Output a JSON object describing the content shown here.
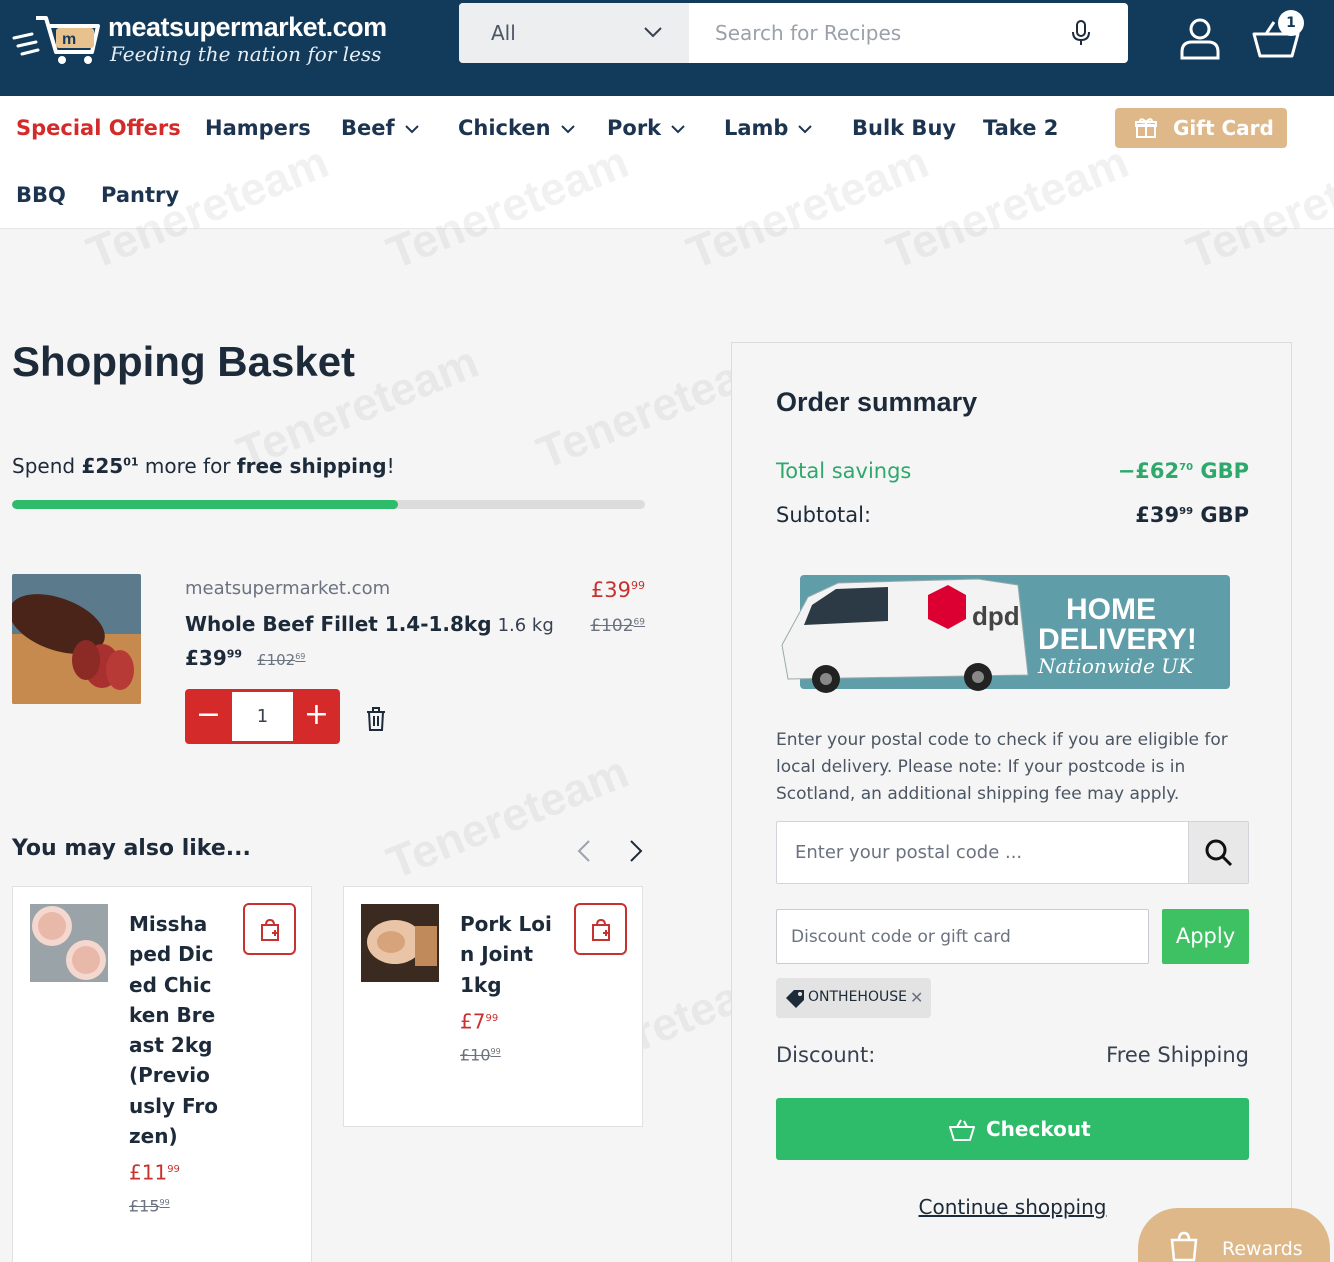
{
  "header": {
    "logo_name": "meatsupermarket.com",
    "logo_tagline": "Feeding the nation for less",
    "search_category": "All",
    "search_placeholder": "Search for Recipes",
    "basket_count": "1"
  },
  "nav": {
    "items": [
      {
        "label": "Special Offers",
        "dropdown": false
      },
      {
        "label": "Hampers",
        "dropdown": false
      },
      {
        "label": "Beef",
        "dropdown": true
      },
      {
        "label": "Chicken",
        "dropdown": true
      },
      {
        "label": "Pork",
        "dropdown": true
      },
      {
        "label": "Lamb",
        "dropdown": true
      },
      {
        "label": "Bulk Buy",
        "dropdown": false
      },
      {
        "label": "Take 2",
        "dropdown": false
      },
      {
        "label": "BBQ",
        "dropdown": false
      },
      {
        "label": "Pantry",
        "dropdown": false
      }
    ],
    "gift_card": "Gift Card"
  },
  "basket": {
    "title": "Shopping Basket",
    "shipping_prefix": "Spend ",
    "shipping_amount": "£25",
    "shipping_amount_pence": "01",
    "shipping_mid": " more for ",
    "shipping_bold": "free shipping",
    "shipping_suffix": "!",
    "progress_percent": 61,
    "item": {
      "vendor": "meatsupermarket.com",
      "name": "Whole Beef Fillet 1.4-1.8kg",
      "weight": "1.6 kg",
      "price_pounds": "£39",
      "price_pence": "99",
      "compare_pounds": "£102",
      "compare_pence": "69",
      "line_total_pounds": "£39",
      "line_total_pence": "99",
      "line_compare_pounds": "£102",
      "line_compare_pence": "69",
      "quantity": "1"
    }
  },
  "recommendations": {
    "title": "You may also like...",
    "items": [
      {
        "name": "Misshaped Diced Chicken Breast 2kg (Previously Frozen)",
        "price_pounds": "£11",
        "price_pence": "99",
        "compare_pounds": "£15",
        "compare_pence": "99"
      },
      {
        "name": "Pork Loin Joint 1kg",
        "price_pounds": "£7",
        "price_pence": "99",
        "compare_pounds": "£10",
        "compare_pence": "99"
      }
    ]
  },
  "summary": {
    "title": "Order summary",
    "savings_label": "Total savings",
    "savings_pounds": "−£62",
    "savings_pence": "70",
    "savings_currency": " GBP",
    "subtotal_label": "Subtotal:",
    "subtotal_pounds": "£39",
    "subtotal_pence": "99",
    "subtotal_currency": " GBP",
    "banner_line1": "HOME",
    "banner_line2": "DELIVERY!",
    "banner_line3": "Nationwide UK",
    "banner_brand": "dpd",
    "postal_message": "Enter your postal code to check if you are eligible for local delivery. Please note: If your postcode is in Scotland, an additional shipping fee may apply.",
    "postal_placeholder": "Enter your postal code ...",
    "discount_placeholder": "Discount code or gift card",
    "apply_label": "Apply",
    "applied_code": "ONTHEHOUSE",
    "discount_label": "Discount:",
    "discount_value": "Free Shipping",
    "checkout_label": "Checkout",
    "continue_label": "Continue shopping"
  },
  "rewards_label": "Rewards",
  "watermark": "Tenereteam"
}
